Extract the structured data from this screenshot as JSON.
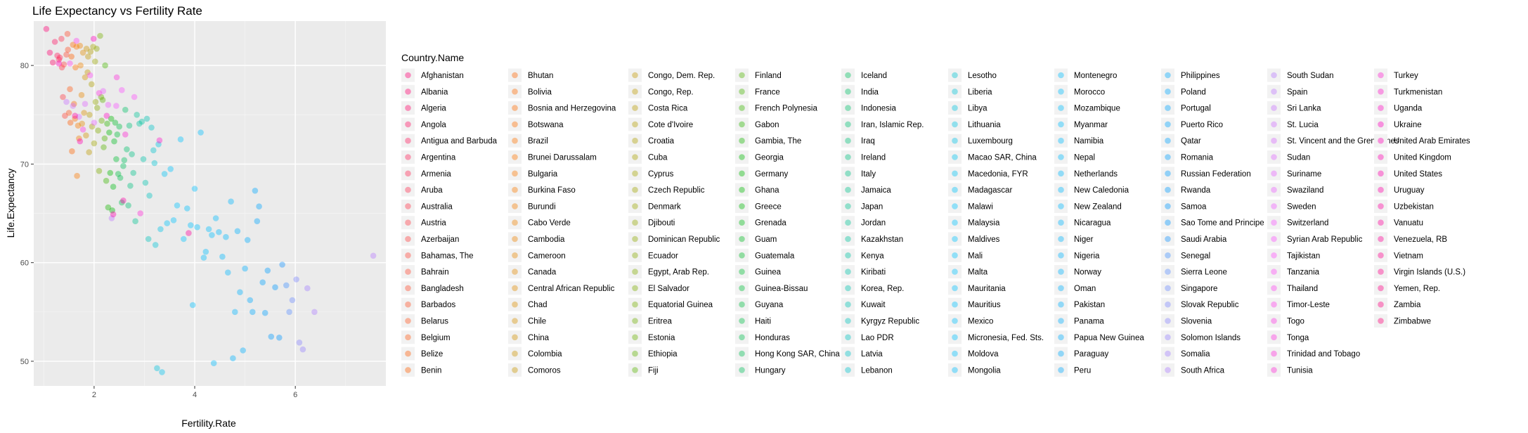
{
  "chart_data": {
    "type": "scatter",
    "title": "Life Expectancy vs Fertility Rate",
    "xlabel": "Fertility.Rate",
    "ylabel": "Life.Expectancy",
    "xlim": [
      0.8,
      7.8
    ],
    "ylim": [
      47.5,
      84.5
    ],
    "x_ticks": [
      2,
      4,
      6
    ],
    "y_ticks": [
      50,
      60,
      70,
      80
    ],
    "grid": true,
    "legend_position": "right",
    "legend_title": "Country.Name",
    "legend_columns": 11,
    "legend_rows": 19,
    "point_alpha": 0.4,
    "countries": [
      "Afghanistan",
      "Albania",
      "Algeria",
      "Angola",
      "Antigua and Barbuda",
      "Argentina",
      "Armenia",
      "Aruba",
      "Australia",
      "Austria",
      "Azerbaijan",
      "Bahamas, The",
      "Bahrain",
      "Bangladesh",
      "Barbados",
      "Belarus",
      "Belgium",
      "Belize",
      "Benin",
      "Bhutan",
      "Bolivia",
      "Bosnia and Herzegovina",
      "Botswana",
      "Brazil",
      "Brunei Darussalam",
      "Bulgaria",
      "Burkina Faso",
      "Burundi",
      "Cabo Verde",
      "Cambodia",
      "Cameroon",
      "Canada",
      "Central African Republic",
      "Chad",
      "Chile",
      "China",
      "Colombia",
      "Comoros",
      "Congo, Dem. Rep.",
      "Congo, Rep.",
      "Costa Rica",
      "Cote d'Ivoire",
      "Croatia",
      "Cuba",
      "Cyprus",
      "Czech Republic",
      "Denmark",
      "Djibouti",
      "Dominican Republic",
      "Ecuador",
      "Egypt, Arab Rep.",
      "El Salvador",
      "Equatorial Guinea",
      "Eritrea",
      "Estonia",
      "Ethiopia",
      "Fiji",
      "Finland",
      "France",
      "French Polynesia",
      "Gabon",
      "Gambia, The",
      "Georgia",
      "Germany",
      "Ghana",
      "Greece",
      "Grenada",
      "Guam",
      "Guatemala",
      "Guinea",
      "Guinea-Bissau",
      "Guyana",
      "Haiti",
      "Honduras",
      "Hong Kong SAR, China",
      "Hungary",
      "Iceland",
      "India",
      "Indonesia",
      "Iran, Islamic Rep.",
      "Iraq",
      "Ireland",
      "Italy",
      "Jamaica",
      "Japan",
      "Jordan",
      "Kazakhstan",
      "Kenya",
      "Kiribati",
      "Korea, Rep.",
      "Kuwait",
      "Kyrgyz Republic",
      "Lao PDR",
      "Latvia",
      "Lebanon",
      "Lesotho",
      "Liberia",
      "Libya",
      "Lithuania",
      "Luxembourg",
      "Macao SAR, China",
      "Macedonia, FYR",
      "Madagascar",
      "Malawi",
      "Malaysia",
      "Maldives",
      "Mali",
      "Malta",
      "Mauritania",
      "Mauritius",
      "Mexico",
      "Micronesia, Fed. Sts.",
      "Moldova",
      "Mongolia",
      "Montenegro",
      "Morocco",
      "Mozambique",
      "Myanmar",
      "Namibia",
      "Nepal",
      "Netherlands",
      "New Caledonia",
      "New Zealand",
      "Nicaragua",
      "Niger",
      "Nigeria",
      "Norway",
      "Oman",
      "Pakistan",
      "Panama",
      "Papua New Guinea",
      "Paraguay",
      "Peru",
      "Philippines",
      "Poland",
      "Portugal",
      "Puerto Rico",
      "Qatar",
      "Romania",
      "Russian Federation",
      "Rwanda",
      "Samoa",
      "Sao Tome and Principe",
      "Saudi Arabia",
      "Senegal",
      "Sierra Leone",
      "Singapore",
      "Slovak Republic",
      "Slovenia",
      "Solomon Islands",
      "Somalia",
      "South Africa",
      "South Sudan",
      "Spain",
      "Sri Lanka",
      "St. Lucia",
      "St. Vincent and the Grenadines",
      "Sudan",
      "Suriname",
      "Swaziland",
      "Sweden",
      "Switzerland",
      "Syrian Arab Republic",
      "Tajikistan",
      "Tanzania",
      "Thailand",
      "Timor-Leste",
      "Togo",
      "Tonga",
      "Trinidad and Tobago",
      "Tunisia",
      "Turkey",
      "Turkmenistan",
      "Uganda",
      "Ukraine",
      "United Arab Emirates",
      "United Kingdom",
      "United States",
      "Uruguay",
      "Uzbekistan",
      "Vanuatu",
      "Venezuela, RB",
      "Vietnam",
      "Virgin Islands (U.S.)",
      "Yemen, Rep.",
      "Zambia",
      "Zimbabwe"
    ],
    "points": [
      [
        1.05,
        83.7
      ],
      [
        1.12,
        81.3
      ],
      [
        1.18,
        80.3
      ],
      [
        1.22,
        82.4
      ],
      [
        1.27,
        81.0
      ],
      [
        1.3,
        80.6
      ],
      [
        1.32,
        80.8
      ],
      [
        1.35,
        82.7
      ],
      [
        1.36,
        79.8
      ],
      [
        1.38,
        76.8
      ],
      [
        1.4,
        80.1
      ],
      [
        1.42,
        74.9
      ],
      [
        1.45,
        81.1
      ],
      [
        1.47,
        83.2
      ],
      [
        1.48,
        81.6
      ],
      [
        1.5,
        75.2
      ],
      [
        1.52,
        77.6
      ],
      [
        1.53,
        74.2
      ],
      [
        1.55,
        80.9
      ],
      [
        1.56,
        71.3
      ],
      [
        1.58,
        82.1
      ],
      [
        1.6,
        76.1
      ],
      [
        1.62,
        74.6
      ],
      [
        1.63,
        79.8
      ],
      [
        1.65,
        81.9
      ],
      [
        1.66,
        68.8
      ],
      [
        1.68,
        73.9
      ],
      [
        1.7,
        72.6
      ],
      [
        1.72,
        82.0
      ],
      [
        1.73,
        80.0
      ],
      [
        1.75,
        77.0
      ],
      [
        1.76,
        74.1
      ],
      [
        1.78,
        81.3
      ],
      [
        1.8,
        75.2
      ],
      [
        1.82,
        78.8
      ],
      [
        1.84,
        72.9
      ],
      [
        1.85,
        81.7
      ],
      [
        1.87,
        79.3
      ],
      [
        1.88,
        80.9
      ],
      [
        1.9,
        71.2
      ],
      [
        1.91,
        75.0
      ],
      [
        1.93,
        81.4
      ],
      [
        1.95,
        78.1
      ],
      [
        1.96,
        73.8
      ],
      [
        1.98,
        81.9
      ],
      [
        2.0,
        72.1
      ],
      [
        2.02,
        80.4
      ],
      [
        2.03,
        76.3
      ],
      [
        2.05,
        81.7
      ],
      [
        2.06,
        75.7
      ],
      [
        2.08,
        73.4
      ],
      [
        2.1,
        69.3
      ],
      [
        2.12,
        83.0
      ],
      [
        2.14,
        76.8
      ],
      [
        2.15,
        74.4
      ],
      [
        2.17,
        76.5
      ],
      [
        2.19,
        71.7
      ],
      [
        2.21,
        72.6
      ],
      [
        2.22,
        80.0
      ],
      [
        2.24,
        68.3
      ],
      [
        2.26,
        74.1
      ],
      [
        2.28,
        65.6
      ],
      [
        2.3,
        73.2
      ],
      [
        2.32,
        69.1
      ],
      [
        2.34,
        74.6
      ],
      [
        2.36,
        65.3
      ],
      [
        2.38,
        67.7
      ],
      [
        2.4,
        72.3
      ],
      [
        2.42,
        74.2
      ],
      [
        2.44,
        70.5
      ],
      [
        2.46,
        73.0
      ],
      [
        2.48,
        69.0
      ],
      [
        2.5,
        73.8
      ],
      [
        2.52,
        68.6
      ],
      [
        2.55,
        66.1
      ],
      [
        2.58,
        69.8
      ],
      [
        2.6,
        70.4
      ],
      [
        2.62,
        75.5
      ],
      [
        2.65,
        71.5
      ],
      [
        2.68,
        65.8
      ],
      [
        2.7,
        73.9
      ],
      [
        2.72,
        67.8
      ],
      [
        2.75,
        71.0
      ],
      [
        2.78,
        69.1
      ],
      [
        2.82,
        64.2
      ],
      [
        2.85,
        75.0
      ],
      [
        2.9,
        74.1
      ],
      [
        2.95,
        74.3
      ],
      [
        2.98,
        70.5
      ],
      [
        3.02,
        68.1
      ],
      [
        3.05,
        74.6
      ],
      [
        3.08,
        62.4
      ],
      [
        3.1,
        66.8
      ],
      [
        3.14,
        73.7
      ],
      [
        3.18,
        71.4
      ],
      [
        3.2,
        70.1
      ],
      [
        3.22,
        61.8
      ],
      [
        3.25,
        49.3
      ],
      [
        3.28,
        72.0
      ],
      [
        3.32,
        63.4
      ],
      [
        3.35,
        48.9
      ],
      [
        3.4,
        69.0
      ],
      [
        3.45,
        64.0
      ],
      [
        3.52,
        69.5
      ],
      [
        3.58,
        64.3
      ],
      [
        3.65,
        65.8
      ],
      [
        3.72,
        72.5
      ],
      [
        3.78,
        62.4
      ],
      [
        3.85,
        65.5
      ],
      [
        3.92,
        63.8
      ],
      [
        3.96,
        55.7
      ],
      [
        4.0,
        67.5
      ],
      [
        4.05,
        63.6
      ],
      [
        4.12,
        73.2
      ],
      [
        4.18,
        60.5
      ],
      [
        4.22,
        61.1
      ],
      [
        4.28,
        63.4
      ],
      [
        4.34,
        62.8
      ],
      [
        4.38,
        49.8
      ],
      [
        4.42,
        64.5
      ],
      [
        4.48,
        63.1
      ],
      [
        4.55,
        60.6
      ],
      [
        4.62,
        62.6
      ],
      [
        4.66,
        59.0
      ],
      [
        4.72,
        66.2
      ],
      [
        4.76,
        50.3
      ],
      [
        4.8,
        55.0
      ],
      [
        4.85,
        63.2
      ],
      [
        4.9,
        57.0
      ],
      [
        4.96,
        51.1
      ],
      [
        5.0,
        59.4
      ],
      [
        5.05,
        62.3
      ],
      [
        5.1,
        56.2
      ],
      [
        5.15,
        55.0
      ],
      [
        5.2,
        67.3
      ],
      [
        5.24,
        64.2
      ],
      [
        5.28,
        65.7
      ],
      [
        5.35,
        58.0
      ],
      [
        5.4,
        54.9
      ],
      [
        5.45,
        59.2
      ],
      [
        5.52,
        52.5
      ],
      [
        5.6,
        57.5
      ],
      [
        5.68,
        52.4
      ],
      [
        5.74,
        59.8
      ],
      [
        5.82,
        57.7
      ],
      [
        5.88,
        55.0
      ],
      [
        5.94,
        56.2
      ],
      [
        6.02,
        58.3
      ],
      [
        6.08,
        51.9
      ],
      [
        6.15,
        51.2
      ],
      [
        6.24,
        57.4
      ],
      [
        6.38,
        55.0
      ],
      [
        7.55,
        60.7
      ],
      [
        2.35,
        64.5
      ],
      [
        1.45,
        76.3
      ],
      [
        1.58,
        75.9
      ],
      [
        1.7,
        74.8
      ],
      [
        1.82,
        76.1
      ],
      [
        2.0,
        74.2
      ],
      [
        2.18,
        77.4
      ],
      [
        2.28,
        76.0
      ],
      [
        2.44,
        75.9
      ],
      [
        2.55,
        77.5
      ],
      [
        2.8,
        76.8
      ],
      [
        1.92,
        79.0
      ],
      [
        1.65,
        82.5
      ],
      [
        1.52,
        80.2
      ],
      [
        2.1,
        77.2
      ],
      [
        1.78,
        73.5
      ],
      [
        2.45,
        78.8
      ],
      [
        2.92,
        65.0
      ],
      [
        2.62,
        73.0
      ],
      [
        3.3,
        72.4
      ],
      [
        2.25,
        74.9
      ],
      [
        1.99,
        82.7
      ],
      [
        1.3,
        80.2
      ],
      [
        1.72,
        72.3
      ],
      [
        2.38,
        64.9
      ],
      [
        2.58,
        66.3
      ],
      [
        1.62,
        74.9
      ],
      [
        3.88,
        63.0
      ]
    ]
  }
}
